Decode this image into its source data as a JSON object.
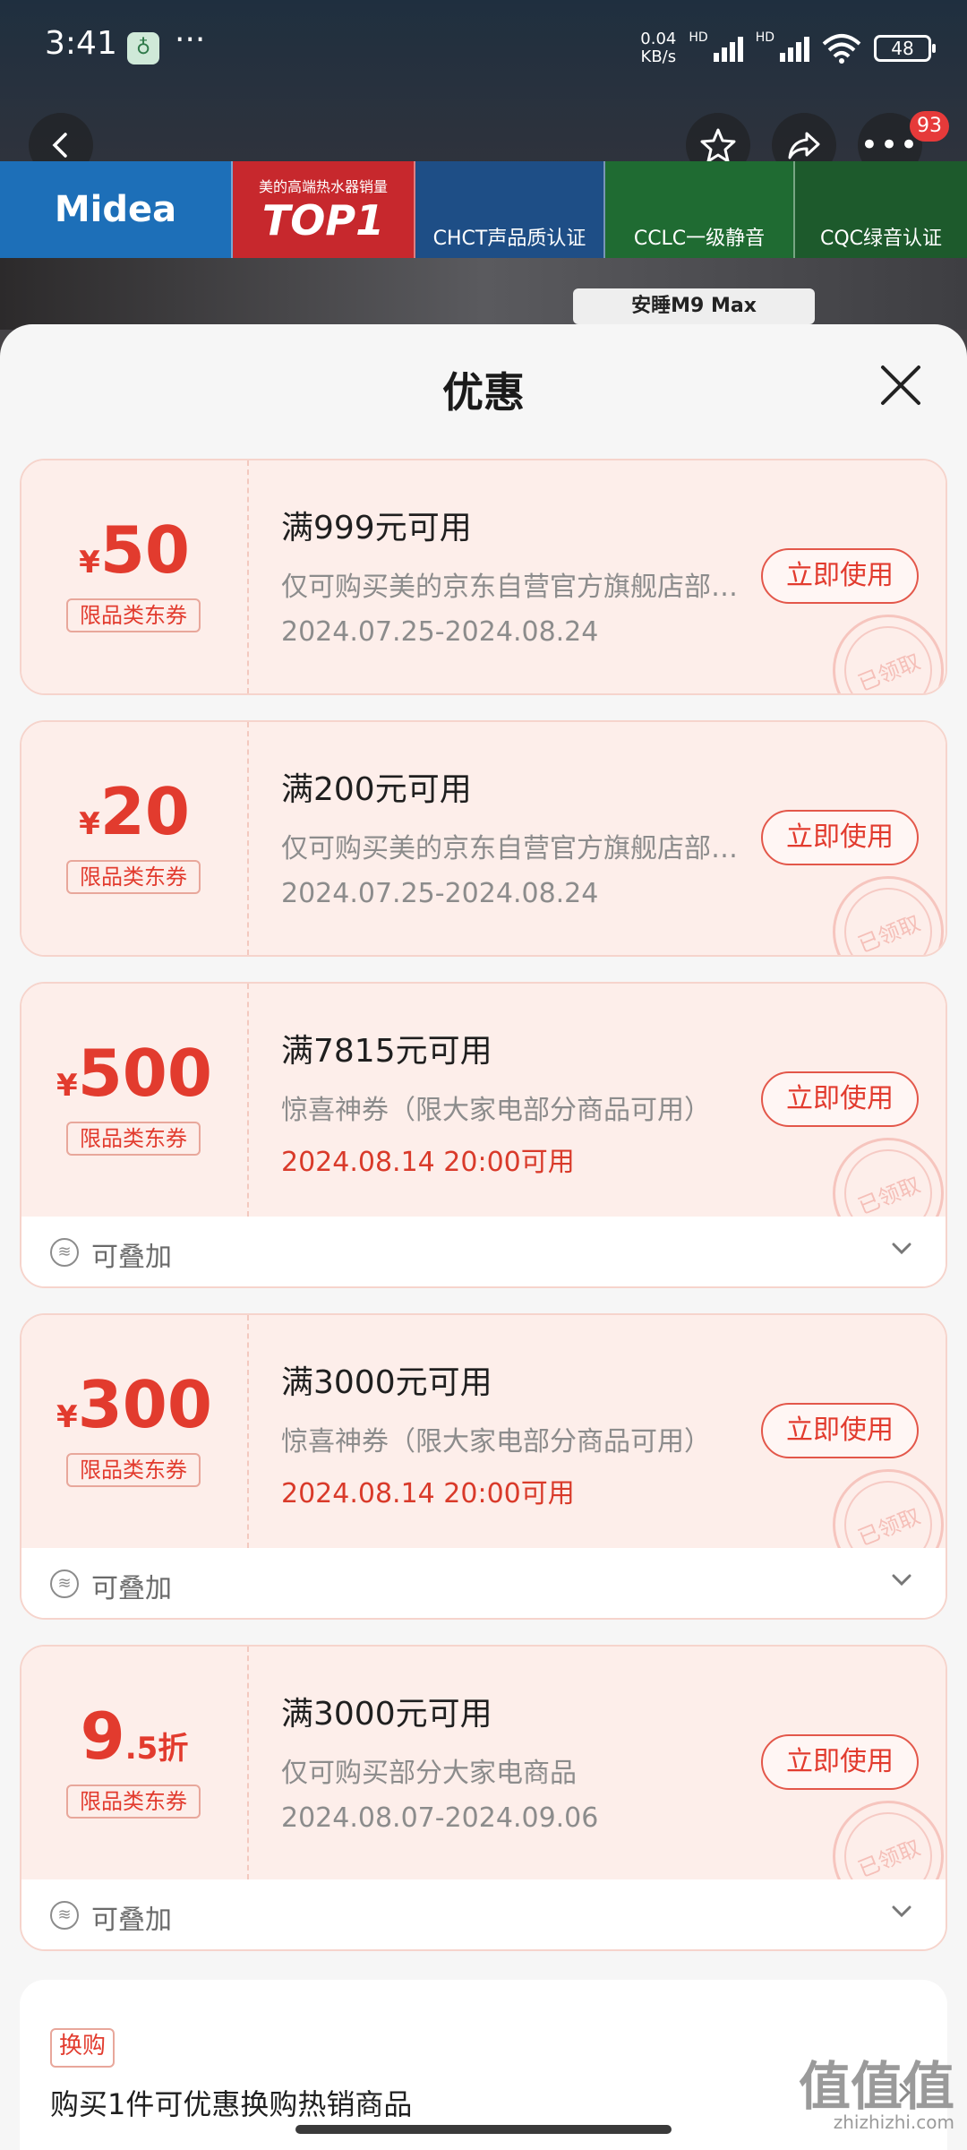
{
  "status_bar": {
    "time": "3:41",
    "dots": "···",
    "net_speed_value": "0.04",
    "net_speed_unit": "KB/s",
    "hd1": "HD",
    "hd2": "HD",
    "battery": "48"
  },
  "nav": {
    "badge": "93"
  },
  "banner": {
    "brand": "Midea",
    "top1_caption": "美的高端热水器销量",
    "top1": "TOP1",
    "chct": "CHCT声品质认证",
    "cclc": "CCLC一级静音",
    "cqc": "CQC绿音认证",
    "product_chip": "安睡M9 Max"
  },
  "sheet": {
    "title": "优惠"
  },
  "coupons": [
    {
      "yen": "¥",
      "amount": "50",
      "unit": "",
      "tag": "限品类东券",
      "condition": "满999元可用",
      "desc": "仅可购买美的京东自营官方旗舰店部分商品",
      "date": "2024.07.25-2024.08.24",
      "button": "立即使用",
      "stamp": "已领取"
    },
    {
      "yen": "¥",
      "amount": "20",
      "unit": "",
      "tag": "限品类东券",
      "condition": "满200元可用",
      "desc": "仅可购买美的京东自营官方旗舰店部分商品",
      "date": "2024.07.25-2024.08.24",
      "button": "立即使用",
      "stamp": "已领取"
    },
    {
      "yen": "¥",
      "amount": "500",
      "unit": "",
      "tag": "限品类东券",
      "condition": "满7815元可用",
      "desc": "惊喜神券（限大家电部分商品可用）",
      "date": "2024.08.14 20:00可用",
      "button": "立即使用",
      "stamp": "已领取",
      "stack_label": "可叠加"
    },
    {
      "yen": "¥",
      "amount": "300",
      "unit": "",
      "tag": "限品类东券",
      "condition": "满3000元可用",
      "desc": "惊喜神券（限大家电部分商品可用）",
      "date": "2024.08.14 20:00可用",
      "button": "立即使用",
      "stamp": "已领取",
      "stack_label": "可叠加"
    },
    {
      "yen": "",
      "amount": "9",
      "unit": ".5折",
      "tag": "限品类东券",
      "condition": "满3000元可用",
      "desc": "仅可购买部分大家电商品",
      "date": "2024.08.07-2024.09.06",
      "button": "立即使用",
      "stamp": "已领取",
      "stack_label": "可叠加"
    }
  ],
  "swap": {
    "tag": "换购",
    "text": "购买1件可优惠换购热销商品"
  },
  "watermark": {
    "main": "值值值",
    "site": "zhizhizhi.com"
  },
  "colors": {
    "accent": "#e23b2e",
    "coupon_bg": "#fdeeea",
    "sheet_bg": "#f6f6f6"
  }
}
